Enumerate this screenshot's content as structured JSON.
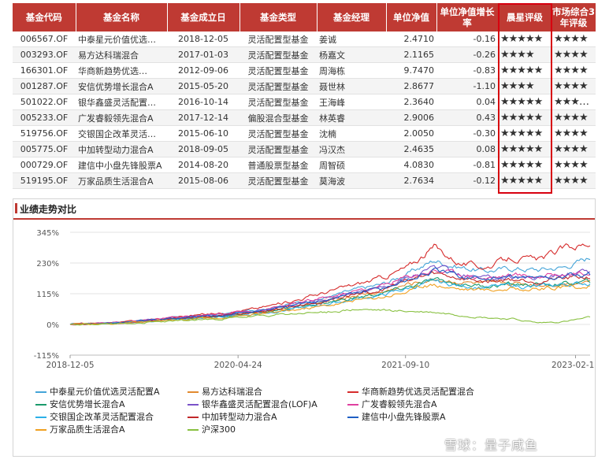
{
  "table": {
    "headers": [
      "基金代码",
      "基金名称",
      "基金成立日",
      "基金类型",
      "基金经理",
      "单位净值",
      "单位净值增长率",
      "晨星评级",
      "市场综合3年评级"
    ],
    "rows": [
      {
        "code": "006567.OF",
        "name": "中泰星元价值优选…",
        "date": "2018-12-05",
        "type": "灵活配置型基金",
        "manager": "姜诚",
        "nav": "2.4710",
        "growth": "-0.16",
        "ms": "★★★★★",
        "mk": "★★★★"
      },
      {
        "code": "003293.OF",
        "name": "易方达科瑞混合",
        "date": "2017-01-03",
        "type": "灵活配置型基金",
        "manager": "杨嘉文",
        "nav": "2.1165",
        "growth": "-0.26",
        "ms": "★★★★",
        "mk": "★★★★"
      },
      {
        "code": "166301.OF",
        "name": "华商新趋势优选…",
        "date": "2012-09-06",
        "type": "灵活配置型基金",
        "manager": "周海栋",
        "nav": "9.7470",
        "growth": "-0.83",
        "ms": "★★★★★",
        "mk": "★★★★"
      },
      {
        "code": "001287.OF",
        "name": "安信优势增长混合A",
        "date": "2015-05-20",
        "type": "灵活配置型基金",
        "manager": "聂世林",
        "nav": "2.8677",
        "growth": "-1.10",
        "ms": "★★★★",
        "mk": "★★★★"
      },
      {
        "code": "501022.OF",
        "name": "银华鑫盛灵活配置…",
        "date": "2016-10-14",
        "type": "灵活配置型基金",
        "manager": "王海峰",
        "nav": "2.3640",
        "growth": "0.04",
        "ms": "★★★★★",
        "mk": "★★★…"
      },
      {
        "code": "005233.OF",
        "name": "广发睿毅领先混合A",
        "date": "2017-12-14",
        "type": "偏股混合型基金",
        "manager": "林英睿",
        "nav": "2.9006",
        "growth": "0.43",
        "ms": "★★★★★",
        "mk": "★★★★"
      },
      {
        "code": "519756.OF",
        "name": "交银国企改革灵活…",
        "date": "2015-06-10",
        "type": "灵活配置型基金",
        "manager": "沈楠",
        "nav": "2.0050",
        "growth": "-0.30",
        "ms": "★★★★★",
        "mk": "★★★★"
      },
      {
        "code": "005775.OF",
        "name": "中加转型动力混合A",
        "date": "2018-09-05",
        "type": "灵活配置型基金",
        "manager": "冯汉杰",
        "nav": "2.4635",
        "growth": "0.08",
        "ms": "★★★★★",
        "mk": "★★★★"
      },
      {
        "code": "000729.OF",
        "name": "建信中小盘先锋股票A",
        "date": "2014-08-20",
        "type": "普通股票型基金",
        "manager": "周智硕",
        "nav": "4.0830",
        "growth": "-0.81",
        "ms": "★★★★★",
        "mk": "★★★★"
      },
      {
        "code": "519195.OF",
        "name": "万家品质生活混合A",
        "date": "2015-08-06",
        "type": "灵活配置型基金",
        "manager": "莫海波",
        "nav": "2.7634",
        "growth": "-0.12",
        "ms": "★★★★★",
        "mk": "★★★★"
      }
    ]
  },
  "panel": {
    "title": "业绩走势对比"
  },
  "colors": {
    "header": "#bf3a33",
    "star": "#e8202a",
    "highlight": "#d7000f"
  },
  "watermark": "雪球：量子咸鱼",
  "chart_data": {
    "type": "line",
    "y_ticks": [
      "345%",
      "230%",
      "115%",
      "0%",
      "-115%"
    ],
    "y_tick_values": [
      345,
      230,
      115,
      0,
      -115
    ],
    "ylim": [
      -115,
      345
    ],
    "x_ticks": [
      "2018-12-05",
      "2020-04-24",
      "2021-09-10",
      "2023-02-10"
    ],
    "x_tick_positions": [
      0,
      0.323,
      0.645,
      0.972
    ],
    "grid": true,
    "legend_placement": "bottom",
    "anchors": [
      0,
      0.1,
      0.2,
      0.3,
      0.36,
      0.42,
      0.48,
      0.55,
      0.6,
      0.65,
      0.7,
      0.75,
      0.8,
      0.85,
      0.9,
      0.95,
      1.0
    ],
    "series": [
      {
        "name": "中泰星元价值优选灵活配置A",
        "color": "#44a4d8",
        "values": [
          0,
          10,
          25,
          40,
          55,
          75,
          95,
          130,
          150,
          190,
          240,
          215,
          200,
          210,
          205,
          215,
          250
        ]
      },
      {
        "name": "易方达科瑞混合",
        "color": "#e28a2f",
        "values": [
          0,
          5,
          20,
          35,
          45,
          60,
          80,
          110,
          120,
          150,
          170,
          160,
          150,
          155,
          150,
          155,
          165
        ]
      },
      {
        "name": "华商新趋势优选灵活配置混合",
        "color": "#d62c2c",
        "values": [
          0,
          8,
          28,
          45,
          60,
          85,
          115,
          150,
          175,
          215,
          290,
          230,
          215,
          250,
          240,
          285,
          305
        ]
      },
      {
        "name": "安信优势增长混合A",
        "color": "#1a9a6c",
        "values": [
          0,
          6,
          20,
          32,
          45,
          60,
          78,
          100,
          115,
          140,
          165,
          150,
          145,
          150,
          148,
          152,
          160
        ]
      },
      {
        "name": "银华鑫盛灵活配置混合(LOF)A",
        "color": "#7a52c9",
        "values": [
          0,
          7,
          22,
          38,
          50,
          68,
          90,
          120,
          140,
          175,
          215,
          185,
          170,
          180,
          175,
          185,
          195
        ]
      },
      {
        "name": "广发睿毅领先混合A",
        "color": "#e040a0",
        "values": [
          0,
          9,
          24,
          40,
          52,
          72,
          95,
          125,
          145,
          180,
          205,
          190,
          175,
          185,
          180,
          190,
          200
        ]
      },
      {
        "name": "交银国企改革灵活配置混合",
        "color": "#2cb0e8",
        "values": [
          0,
          5,
          18,
          30,
          40,
          55,
          72,
          95,
          110,
          135,
          160,
          145,
          140,
          145,
          140,
          150,
          155
        ]
      },
      {
        "name": "中加转型动力混合A",
        "color": "#c2282a",
        "values": [
          0,
          6,
          20,
          35,
          46,
          64,
          85,
          115,
          130,
          165,
          190,
          175,
          160,
          170,
          165,
          170,
          178
        ]
      },
      {
        "name": "建信中小盘先锋股票A",
        "color": "#1f5fc4",
        "values": [
          0,
          7,
          23,
          37,
          50,
          66,
          88,
          118,
          135,
          168,
          200,
          180,
          170,
          178,
          172,
          180,
          188
        ]
      },
      {
        "name": "万家品质生活混合A",
        "color": "#f0a020",
        "values": [
          0,
          4,
          15,
          28,
          38,
          52,
          68,
          90,
          105,
          125,
          150,
          135,
          130,
          135,
          132,
          138,
          142
        ]
      },
      {
        "name": "沪深300",
        "color": "#88c040",
        "values": [
          0,
          3,
          12,
          22,
          30,
          38,
          45,
          55,
          52,
          48,
          45,
          35,
          25,
          20,
          5,
          10,
          25
        ]
      }
    ]
  }
}
